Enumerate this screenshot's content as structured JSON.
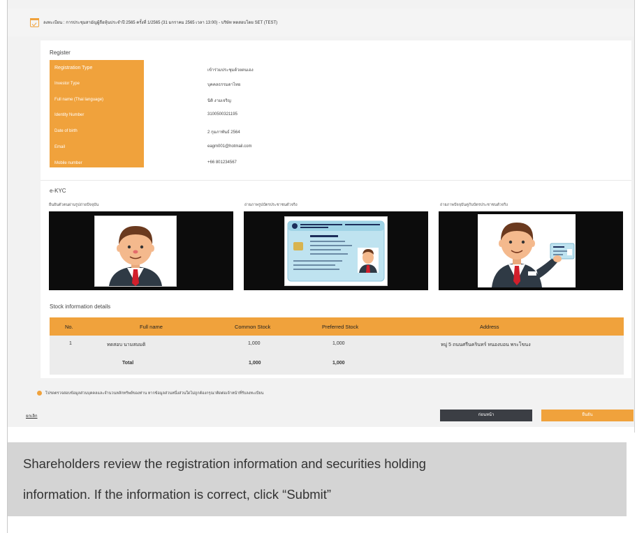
{
  "header": {
    "text": "ลงทะเบียน : การประชุมสามัญผู้ถือหุ้นประจำปี 2565 ครั้งที่ 1/2565 (31 มกราคม 2565 เวลา 13:00) - บริษัท ทดสอบโดย SET (TEST)"
  },
  "register": {
    "title": "Register",
    "rows": [
      {
        "label": "Registration Type",
        "value": "เข้าร่วมประชุมด้วยตนเอง"
      },
      {
        "label": "Investor Type",
        "value": "บุคคลธรรมดาไทย"
      },
      {
        "label": "Full name (Thai language)",
        "value": "นิติ งามเจริญ"
      },
      {
        "label": "Identity Number",
        "value": "3100500321195"
      },
      {
        "label": "Date of birth",
        "value": "2 กุมภาพันธ์ 2564"
      },
      {
        "label": "Email",
        "value": "eagm001@hotmail.com"
      },
      {
        "label": "Mobile number",
        "value": "+66 801234567"
      }
    ]
  },
  "ekyc": {
    "title": "e-KYC",
    "panels": [
      {
        "label": "ยืนยันตัวตนผ่านรูปถ่ายปัจจุบัน",
        "image": "face-photo"
      },
      {
        "label": "ถ่ายภาพรูปบัตรประชาชนตัวจริง",
        "image": "id-card-photo"
      },
      {
        "label": "ถ่ายภาพปัจจุบันคู่กับบัตรประชาชนตัวจริง",
        "image": "person-holding-card-photo"
      }
    ]
  },
  "stock": {
    "title": "Stock information details",
    "columns": [
      "No.",
      "Full name",
      "Common Stock",
      "Preferred Stock",
      "Address"
    ],
    "rows": [
      {
        "no": "1",
        "name": "ทดสอบ นามสมมติ",
        "common": "1,000",
        "preferred": "1,000",
        "address": "หมู่ 5 ถนนศรีนครินทร์ หนองบอน พระโขนง"
      }
    ],
    "total": {
      "label": "Total",
      "common": "1,000",
      "preferred": "1,000"
    }
  },
  "note": "โปรดตรวจสอบข้อมูลส่วนบุคคลและจำนวนหลักทรัพย์ของท่าน หากข้อมูลส่วนหนึ่งส่วนใดไม่ถูกต้องกรุณาติดต่อเจ้าหน้าที่รับลงทะเบียน",
  "actions": {
    "cancel": "ยกเลิก",
    "back": "ก่อนหน้า",
    "submit": "ยืนยัน"
  },
  "caption": {
    "line1": "Shareholders review the registration information and securities holding",
    "line2": "information. If the information is correct, click “Submit”"
  },
  "colors": {
    "accent": "#f0a23c",
    "dark_button": "#3b3e44",
    "caption_bg": "#d4d4d4"
  }
}
